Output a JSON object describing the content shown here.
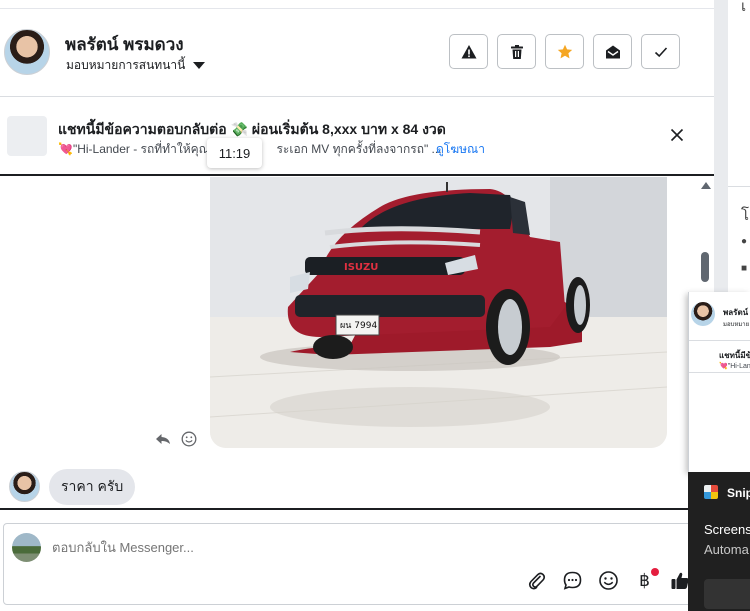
{
  "header": {
    "contact_name": "พลรัตน์ พรมดวง",
    "assign_label": "มอบหมายการสนทนานี้"
  },
  "ad": {
    "title": "แชทนี้มีข้อความตอบกลับต่อ 💸 ผ่อนเริ่มต้น 8,xxx บาท x 84 งวด",
    "subtitle": "💘\"Hi-Lander - รถที่ทำให้คุณ",
    "subtitle_rest": "ระเอก MV ทุกครั้งที่ลงจากรถ\" ...",
    "link": "ดูโฆษณา"
  },
  "tooltip_time": "11:19",
  "photo": {
    "plate": "ผน 7994",
    "brand": "ISUZU"
  },
  "message": {
    "text": "ราคา ครับ"
  },
  "composer": {
    "placeholder": "ตอบกลับใน Messenger...",
    "currency_symbol": "฿"
  },
  "popup": {
    "name": "พลรัตน์",
    "assign": "มอบหมาย",
    "title": "แชทนี้มีข้",
    "subtitle": "💘\"Hi-Lan"
  },
  "toast": {
    "app": "Snip",
    "line1": "Screens",
    "line2": "Automa"
  },
  "right_panel": {
    "char_top": "เ",
    "char_mid": "โ"
  },
  "icons": {
    "report": "warning-icon",
    "delete": "trash-icon",
    "star": "star-icon",
    "read": "envelope-open-icon",
    "done": "check-icon"
  },
  "colors": {
    "accent": "#1877f2",
    "star": "#f5a623",
    "bubble": "#e4e6eb",
    "notify_dot": "#e41e3f"
  }
}
